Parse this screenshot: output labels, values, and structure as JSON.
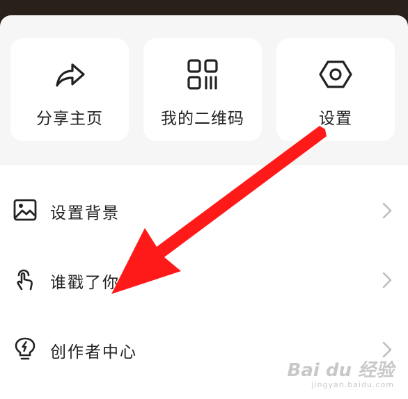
{
  "quick_actions": [
    {
      "label": "分享主页",
      "icon": "share-icon"
    },
    {
      "label": "我的二维码",
      "icon": "qr-code-icon"
    },
    {
      "label": "设置",
      "icon": "settings-hexagon-icon"
    }
  ],
  "menu": [
    {
      "label": "设置背景",
      "icon": "image-icon"
    },
    {
      "label": "谁戳了你",
      "icon": "tap-hand-icon"
    },
    {
      "label": "创作者中心",
      "icon": "lightbulb-icon"
    }
  ],
  "colors": {
    "top_bar": "#2a201a",
    "sheet_bg": "#f6f6f6",
    "card_bg": "#ffffff",
    "text": "#222222",
    "chevron": "#bcbcbc",
    "annotation_arrow": "#ff1a1a"
  },
  "watermark": {
    "main": "Bai du 经验",
    "sub": "jingyan.baidu.com"
  }
}
